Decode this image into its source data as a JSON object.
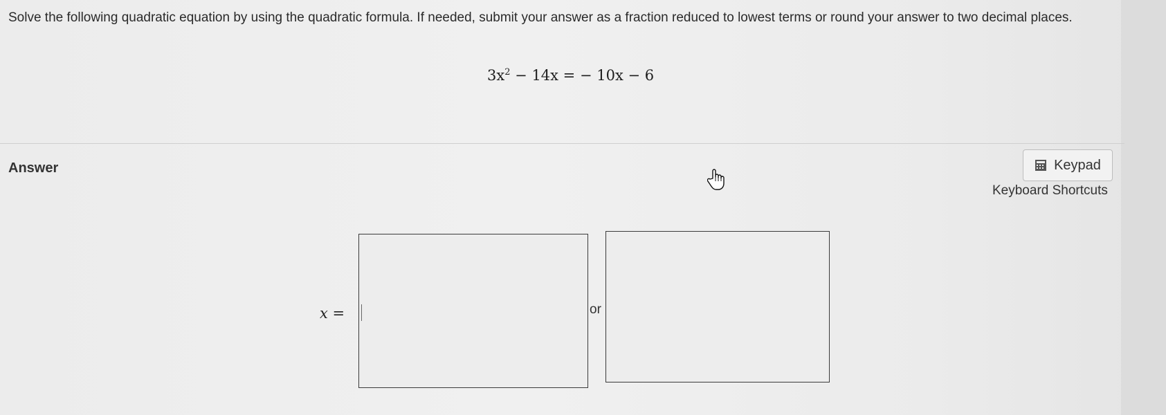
{
  "question": {
    "text": "Solve the following quadratic equation by using the quadratic formula. If needed, submit your answer as a fraction reduced to lowest terms or round your answer to two decimal places."
  },
  "equation": {
    "lhs_coef": "3x",
    "exponent": "2",
    "rest": " − 14x = − 10x − 6"
  },
  "answer": {
    "label": "Answer",
    "keypad_label": "Keypad",
    "keypad_icon": "calculator-icon",
    "shortcuts_label": "Keyboard Shortcuts",
    "x_var": "x",
    "x_equals": " =",
    "or_label": "or",
    "input1_value": "",
    "input2_value": ""
  },
  "colors": {
    "background": "#ececec",
    "box_border": "#3a3a3a",
    "text": "#222222"
  }
}
